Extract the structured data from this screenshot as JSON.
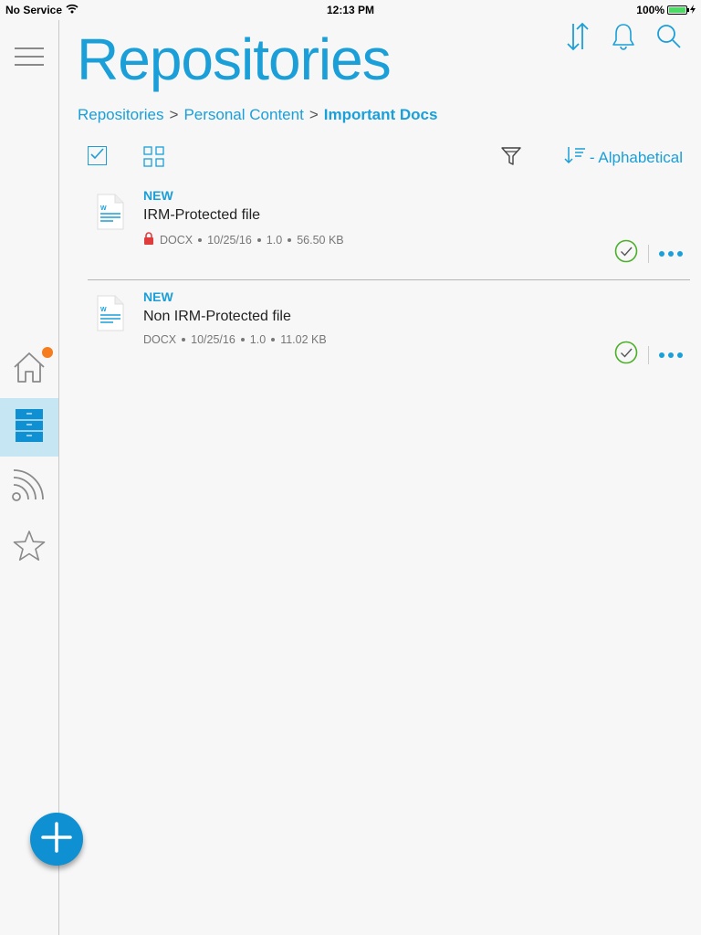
{
  "status_bar": {
    "carrier": "No Service",
    "time": "12:13 PM",
    "battery": "100%",
    "battery_level": 1.0
  },
  "header": {
    "title": "Repositories",
    "icons": [
      "sort-icon",
      "bell-icon",
      "search-icon"
    ]
  },
  "breadcrumb": {
    "items": [
      {
        "label": "Repositories"
      },
      {
        "label": "Personal Content"
      },
      {
        "label": "Important Docs"
      }
    ],
    "separator": ">"
  },
  "toolbar": {
    "sort_label": "- Alphabetical"
  },
  "files": [
    {
      "badge": "NEW",
      "name": "IRM-Protected file",
      "protected": true,
      "type": "DOCX",
      "date": "10/25/16",
      "version": "1.0",
      "size": "56.50 KB"
    },
    {
      "badge": "NEW",
      "name": "Non IRM-Protected file",
      "protected": false,
      "type": "DOCX",
      "date": "10/25/16",
      "version": "1.0",
      "size": "11.02 KB"
    }
  ],
  "rail": {
    "items": [
      "home-icon",
      "repositories-icon",
      "feed-icon",
      "favorites-icon"
    ],
    "active": "repositories-icon",
    "home_has_notification": true
  },
  "colors": {
    "accent": "#1a9fd9",
    "active_rail_bg": "#c6e6f3",
    "notification": "#f57c1f",
    "check_green": "#4caf2a",
    "lock_red": "#e03c3c"
  }
}
